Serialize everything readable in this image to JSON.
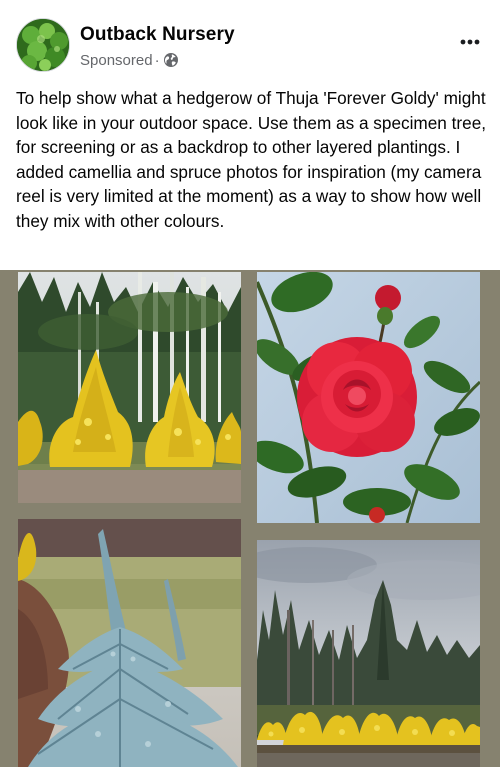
{
  "post": {
    "page_name": "Outback Nursery",
    "sponsored_label": "Sponsored",
    "dot": "·",
    "text": "To help show what a hedgerow of Thuja 'Forever Goldy' might look like in your outdoor space. Use them as a specimen tree, for screening or as a backdrop to other layered plantings. I added camellia and spruce photos for inspiration (my camera reel is very limited at the moment) as a way to show how well they mix with other colours.",
    "icons": {
      "audience": "globe-icon",
      "more": "more-options-icon"
    }
  },
  "colors": {
    "grid_background": "#86826f",
    "gold_foliage": "#e8c51f",
    "camellia_red": "#e8253f",
    "spruce_blue": "#8fb3c0"
  },
  "photos": [
    {
      "name": "photo-thuja-row"
    },
    {
      "name": "photo-red-camellia"
    },
    {
      "name": "photo-blue-spruce"
    },
    {
      "name": "photo-hedgerow-landscape"
    }
  ]
}
